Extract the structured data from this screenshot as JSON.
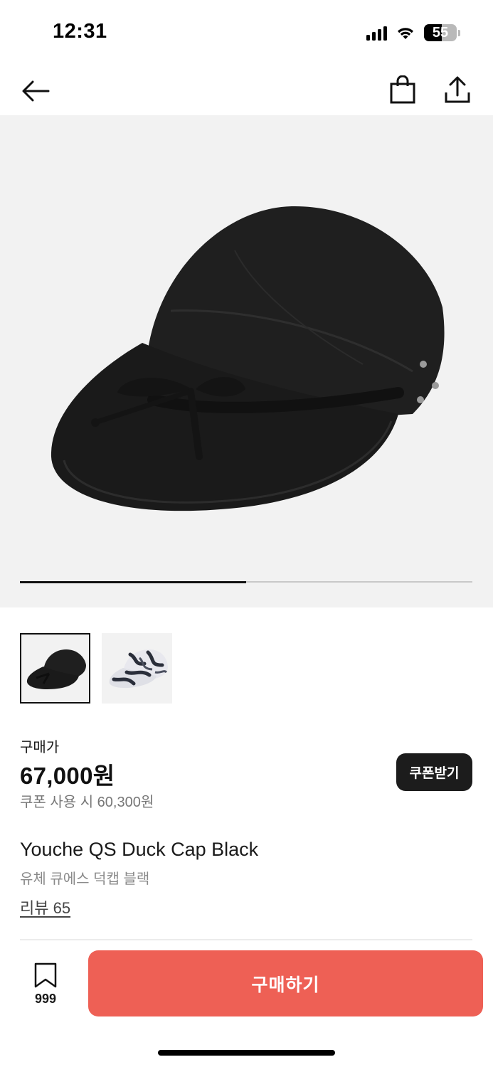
{
  "status_bar": {
    "time": "12:31",
    "battery_level": "55",
    "icons": [
      "signal-icon",
      "wifi-icon",
      "battery-icon"
    ]
  },
  "nav": {
    "icons": [
      "back-arrow-icon",
      "shopping-bag-icon",
      "share-icon"
    ]
  },
  "gallery": {
    "image_count": 2,
    "current_index": 1,
    "progress_fraction": 0.5
  },
  "price": {
    "label": "구매가",
    "amount": "67,000원",
    "coupon_price": "쿠폰 사용 시 60,300원",
    "coupon_button": "쿠폰받기"
  },
  "product": {
    "name_en": "Youche QS Duck Cap Black",
    "name_ko": "유체 큐에스 덕캡 블랙",
    "review_link": "리뷰 65"
  },
  "bottom_bar": {
    "bookmark_count": "999",
    "buy_button": "구매하기"
  },
  "colors": {
    "buy_button": "#ee6055",
    "coupon_button": "#1c1c1c",
    "hero_background": "#f2f2f2"
  }
}
